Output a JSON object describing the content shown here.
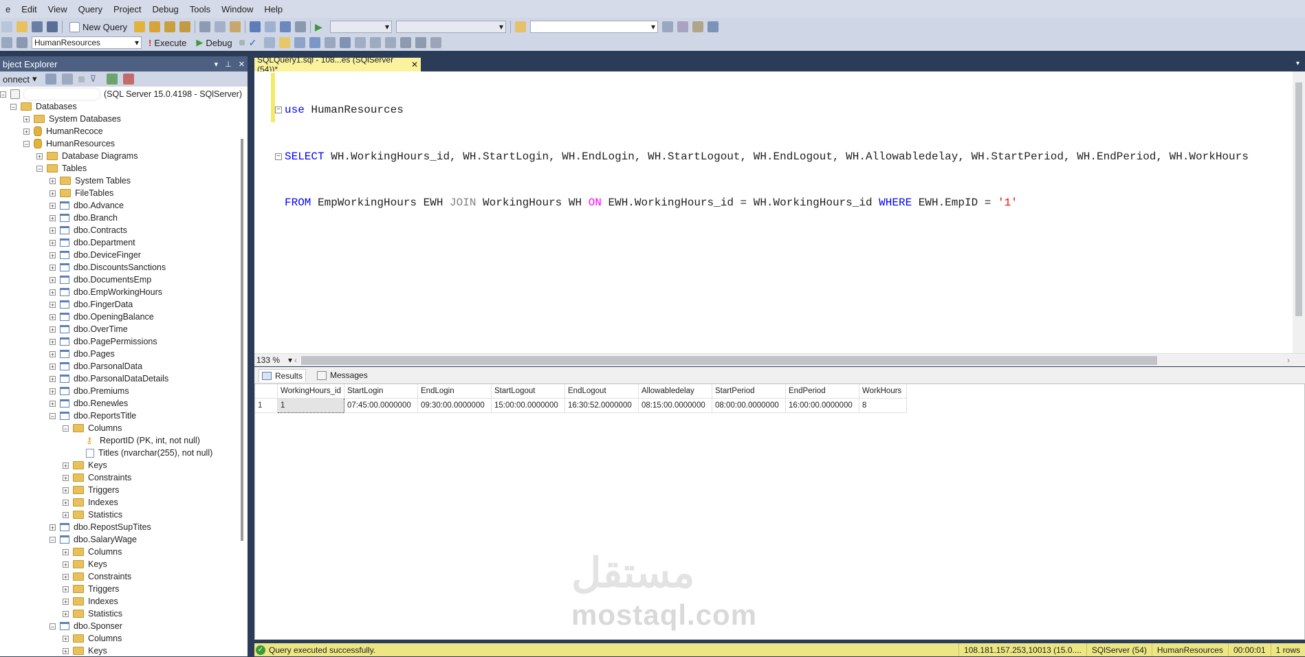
{
  "menu": [
    "e",
    "Edit",
    "View",
    "Query",
    "Project",
    "Debug",
    "Tools",
    "Window",
    "Help"
  ],
  "toolbar": {
    "new_query": "New Query",
    "database_select": "HumanResources",
    "execute": "Execute",
    "debug": "Debug"
  },
  "object_explorer": {
    "title": "bject Explorer",
    "connect": "onnect",
    "server": "(SQL Server 15.0.4198 - SQlServer)",
    "tree": [
      {
        "label": "Databases",
        "indent": 1,
        "expander": "−",
        "icon": "folder-icon"
      },
      {
        "label": "System Databases",
        "indent": 2,
        "expander": "+",
        "icon": "folder-icon"
      },
      {
        "label": "HumanRecoce",
        "indent": 2,
        "expander": "+",
        "icon": "database-icon"
      },
      {
        "label": "HumanResources",
        "indent": 2,
        "expander": "−",
        "icon": "database-icon"
      },
      {
        "label": "Database Diagrams",
        "indent": 3,
        "expander": "+",
        "icon": "folder-icon"
      },
      {
        "label": "Tables",
        "indent": 3,
        "expander": "−",
        "icon": "folder-icon"
      },
      {
        "label": "System Tables",
        "indent": 4,
        "expander": "+",
        "icon": "folder-icon"
      },
      {
        "label": "FileTables",
        "indent": 4,
        "expander": "+",
        "icon": "folder-icon"
      },
      {
        "label": "dbo.Advance",
        "indent": 4,
        "expander": "+",
        "icon": "table-icon"
      },
      {
        "label": "dbo.Branch",
        "indent": 4,
        "expander": "+",
        "icon": "table-icon"
      },
      {
        "label": "dbo.Contracts",
        "indent": 4,
        "expander": "+",
        "icon": "table-icon"
      },
      {
        "label": "dbo.Department",
        "indent": 4,
        "expander": "+",
        "icon": "table-icon"
      },
      {
        "label": "dbo.DeviceFinger",
        "indent": 4,
        "expander": "+",
        "icon": "table-icon"
      },
      {
        "label": "dbo.DiscountsSanctions",
        "indent": 4,
        "expander": "+",
        "icon": "table-icon"
      },
      {
        "label": "dbo.DocumentsEmp",
        "indent": 4,
        "expander": "+",
        "icon": "table-icon"
      },
      {
        "label": "dbo.EmpWorkingHours",
        "indent": 4,
        "expander": "+",
        "icon": "table-icon"
      },
      {
        "label": "dbo.FingerData",
        "indent": 4,
        "expander": "+",
        "icon": "table-icon"
      },
      {
        "label": "dbo.OpeningBalance",
        "indent": 4,
        "expander": "+",
        "icon": "table-icon"
      },
      {
        "label": "dbo.OverTime",
        "indent": 4,
        "expander": "+",
        "icon": "table-icon"
      },
      {
        "label": "dbo.PagePermissions",
        "indent": 4,
        "expander": "+",
        "icon": "table-icon"
      },
      {
        "label": "dbo.Pages",
        "indent": 4,
        "expander": "+",
        "icon": "table-icon"
      },
      {
        "label": "dbo.ParsonalData",
        "indent": 4,
        "expander": "+",
        "icon": "table-icon"
      },
      {
        "label": "dbo.ParsonalDataDetails",
        "indent": 4,
        "expander": "+",
        "icon": "table-icon"
      },
      {
        "label": "dbo.Premiums",
        "indent": 4,
        "expander": "+",
        "icon": "table-icon"
      },
      {
        "label": "dbo.Renewles",
        "indent": 4,
        "expander": "+",
        "icon": "table-icon"
      },
      {
        "label": "dbo.ReportsTitle",
        "indent": 4,
        "expander": "−",
        "icon": "table-icon"
      },
      {
        "label": "Columns",
        "indent": 5,
        "expander": "−",
        "icon": "folder-icon"
      },
      {
        "label": "ReportID (PK, int, not null)",
        "indent": 6,
        "expander": "",
        "icon": "key-icon"
      },
      {
        "label": "Titles (nvarchar(255), not null)",
        "indent": 6,
        "expander": "",
        "icon": "column-icon"
      },
      {
        "label": "Keys",
        "indent": 5,
        "expander": "+",
        "icon": "folder-icon"
      },
      {
        "label": "Constraints",
        "indent": 5,
        "expander": "+",
        "icon": "folder-icon"
      },
      {
        "label": "Triggers",
        "indent": 5,
        "expander": "+",
        "icon": "folder-icon"
      },
      {
        "label": "Indexes",
        "indent": 5,
        "expander": "+",
        "icon": "folder-icon"
      },
      {
        "label": "Statistics",
        "indent": 5,
        "expander": "+",
        "icon": "folder-icon"
      },
      {
        "label": "dbo.RepostSupTites",
        "indent": 4,
        "expander": "+",
        "icon": "table-icon"
      },
      {
        "label": "dbo.SalaryWage",
        "indent": 4,
        "expander": "−",
        "icon": "table-icon"
      },
      {
        "label": "Columns",
        "indent": 5,
        "expander": "+",
        "icon": "folder-icon"
      },
      {
        "label": "Keys",
        "indent": 5,
        "expander": "+",
        "icon": "folder-icon"
      },
      {
        "label": "Constraints",
        "indent": 5,
        "expander": "+",
        "icon": "folder-icon"
      },
      {
        "label": "Triggers",
        "indent": 5,
        "expander": "+",
        "icon": "folder-icon"
      },
      {
        "label": "Indexes",
        "indent": 5,
        "expander": "+",
        "icon": "folder-icon"
      },
      {
        "label": "Statistics",
        "indent": 5,
        "expander": "+",
        "icon": "folder-icon"
      },
      {
        "label": "dbo.Sponser",
        "indent": 4,
        "expander": "−",
        "icon": "table-icon"
      },
      {
        "label": "Columns",
        "indent": 5,
        "expander": "+",
        "icon": "folder-icon"
      },
      {
        "label": "Keys",
        "indent": 5,
        "expander": "+",
        "icon": "folder-icon"
      }
    ]
  },
  "editor": {
    "tab_title": "SQLQuery1.sql - 108...es (SQlServer (54))*",
    "line1_kw": "use",
    "line1_rest": " HumanResources",
    "line2_kw": "SELECT",
    "line2_rest": " WH.WorkingHours_id, WH.StartLogin, WH.EndLogin, WH.StartLogout, WH.EndLogout, WH.Allowabledelay, WH.StartPeriod, WH.EndPeriod, WH.WorkHours",
    "line3_from": "FROM",
    "line3_a": " EmpWorkingHours EWH ",
    "line3_join": "JOIN",
    "line3_b": " WorkingHours WH ",
    "line3_on": "ON",
    "line3_c": " EWH.WorkingHours_id = WH.WorkingHours_id ",
    "line3_where": "WHERE",
    "line3_d": " EWH.EmpID = ",
    "line3_str": "'1'",
    "zoom": "133 %"
  },
  "results": {
    "tab_results": "Results",
    "tab_messages": "Messages",
    "columns": [
      "WorkingHours_id",
      "StartLogin",
      "EndLogin",
      "StartLogout",
      "EndLogout",
      "Allowabledelay",
      "StartPeriod",
      "EndPeriod",
      "WorkHours"
    ],
    "rows": [
      {
        "num": "1",
        "cells": [
          "1",
          "07:45:00.0000000",
          "09:30:00.0000000",
          "15:00:00.0000000",
          "16:30:52.0000000",
          "08:15:00.0000000",
          "08:00:00.0000000",
          "16:00:00.0000000",
          "8"
        ]
      }
    ]
  },
  "status": {
    "message": "Query executed successfully.",
    "server": "108.181.157.253,10013 (15.0....",
    "instance": "SQlServer (54)",
    "database": "HumanResources",
    "elapsed": "00:00:01",
    "rows": "1 rows"
  },
  "watermark": {
    "arabic": "مستقل",
    "latin": "mostaql.com"
  },
  "colors": {
    "ide_frame": "#2b3c59",
    "tab_active": "#fbf29e",
    "status_bar": "#ece784",
    "keyword": "#0000ff",
    "string": "#ff0000"
  }
}
